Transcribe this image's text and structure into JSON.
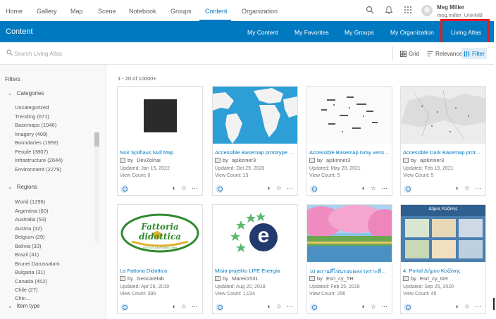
{
  "topnav": {
    "items": [
      "Home",
      "Gallery",
      "Map",
      "Scene",
      "Notebook",
      "Groups",
      "Content",
      "Organization"
    ],
    "user_name": "Meg Miller",
    "user_id": "meg.miller_UnivMB"
  },
  "header": {
    "title": "Content",
    "tabs": [
      "My Content",
      "My Favorites",
      "My Groups",
      "My Organization",
      "Living Atlas"
    ],
    "active_tab": "Living Atlas"
  },
  "search": {
    "placeholder": "Search Living Atlas"
  },
  "view": {
    "grid": "Grid",
    "sort": "Relevance",
    "filter": "Filter"
  },
  "sidebar": {
    "title": "Filters",
    "categories_label": "Categories",
    "categories": [
      "Uncategorized",
      "Trending (671)",
      "Basemaps (1046)",
      "Imagery (409)",
      "Boundaries (1959)",
      "People (3807)",
      "Infrastructure (2044)",
      "Environment (2279)"
    ],
    "regions_label": "Regions",
    "regions": [
      "World (1296)",
      "Argentina (60)",
      "Australia (53)",
      "Austria (32)",
      "Belgium (29)",
      "Bolivia (33)",
      "Brazil (41)",
      "Brunei Darussalam",
      "Bulgaria (31)",
      "Canada (452)",
      "Chile (27)",
      "Chin..."
    ],
    "item_type_label": "Item type"
  },
  "results": {
    "count_text": "1 - 20 of 10000+"
  },
  "cards": [
    {
      "title": "Noir Spilhaus Null Map",
      "owner": "DevZolnai",
      "updated": "Updated: Jan 15, 2022",
      "views": "View Count: 0"
    },
    {
      "title": "Accessible Basemap prototype v...",
      "owner": "ajskinner3",
      "updated": "Updated: Oct 29, 2020",
      "views": "View Count: 13"
    },
    {
      "title": "Accessible Basemap Gray versio...",
      "owner": "ajskinner3",
      "updated": "Updated: May 20, 2021",
      "views": "View Count: 5"
    },
    {
      "title": "Accessible Dark Basemap protot...",
      "owner": "ajskinner3",
      "updated": "Updated: Feb 19, 2021",
      "views": "View Count: 5"
    },
    {
      "title": "La Fattoria Didattica",
      "owner": "Geocarelab",
      "updated": "Updated: Apr 26, 2019",
      "views": "View Count: 396",
      "thumb_text": [
        "Fattoria didattica",
        "ISTITUTO ANTONIO ZONI"
      ]
    },
    {
      "title": "Misia projektu LIFE Energia",
      "owner": "Marek1531",
      "updated": "Updated: Aug 20, 2018",
      "views": "View Count: 1,034",
      "thumb_text": [
        "e"
      ]
    },
    {
      "title": "10 สถานที่ไฟนรอบคลกาคราะที่ญี่ปุ่น",
      "owner": "Esri_cy_TH",
      "updated": "Updated: Feb 25, 2016",
      "views": "View Count: 256"
    },
    {
      "title": "4. Portal Δήμου Κοζάνης",
      "owner": "Esri_cy_GR",
      "updated": "Updated: Sep 25, 2020",
      "views": "View Count: 45",
      "thumb_text": [
        "Δήμος Κοζάνης"
      ]
    }
  ]
}
